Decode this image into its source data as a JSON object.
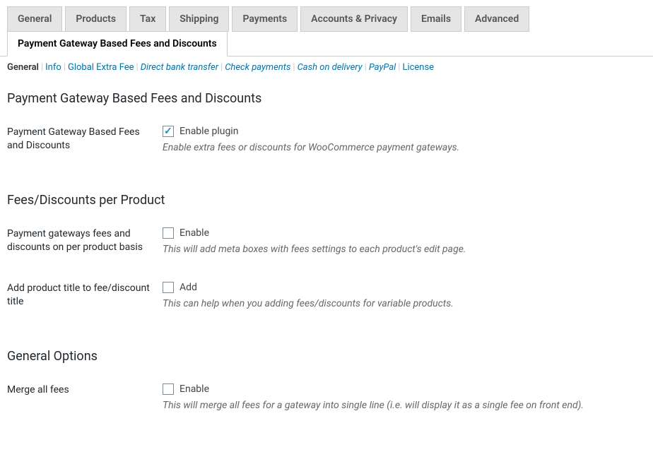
{
  "tabs": [
    {
      "label": "General",
      "active": false
    },
    {
      "label": "Products",
      "active": false
    },
    {
      "label": "Tax",
      "active": false
    },
    {
      "label": "Shipping",
      "active": false
    },
    {
      "label": "Payments",
      "active": false
    },
    {
      "label": "Accounts & Privacy",
      "active": false
    },
    {
      "label": "Emails",
      "active": false
    },
    {
      "label": "Advanced",
      "active": false
    },
    {
      "label": "Payment Gateway Based Fees and Discounts",
      "active": true
    }
  ],
  "subnav": [
    {
      "label": "General",
      "current": true,
      "italic": false
    },
    {
      "label": "Info",
      "current": false,
      "italic": false
    },
    {
      "label": "Global Extra Fee",
      "current": false,
      "italic": false
    },
    {
      "label": "Direct bank transfer",
      "current": false,
      "italic": true
    },
    {
      "label": "Check payments",
      "current": false,
      "italic": true
    },
    {
      "label": "Cash on delivery",
      "current": false,
      "italic": true
    },
    {
      "label": "PayPal",
      "current": false,
      "italic": true
    },
    {
      "label": "License",
      "current": false,
      "italic": false
    }
  ],
  "section1": {
    "title": "Payment Gateway Based Fees and Discounts",
    "row_label": "Payment Gateway Based Fees and Discounts",
    "checkbox_label": "Enable plugin",
    "checked": true,
    "description": "Enable extra fees or discounts for WooCommerce payment gateways."
  },
  "section2": {
    "title": "Fees/Discounts per Product",
    "row1_label": "Payment gateways fees and discounts on per product basis",
    "row1_checkbox_label": "Enable",
    "row1_checked": false,
    "row1_description": "This will add meta boxes with fees settings to each product's edit page.",
    "row2_label": "Add product title to fee/discount title",
    "row2_checkbox_label": "Add",
    "row2_checked": false,
    "row2_description": "This can help when you adding fees/discounts for variable products."
  },
  "section3": {
    "title": "General Options",
    "row_label": "Merge all fees",
    "checkbox_label": "Enable",
    "checked": false,
    "description": "This will merge all fees for a gateway into single line (i.e. will display it as a single fee on front end)."
  }
}
